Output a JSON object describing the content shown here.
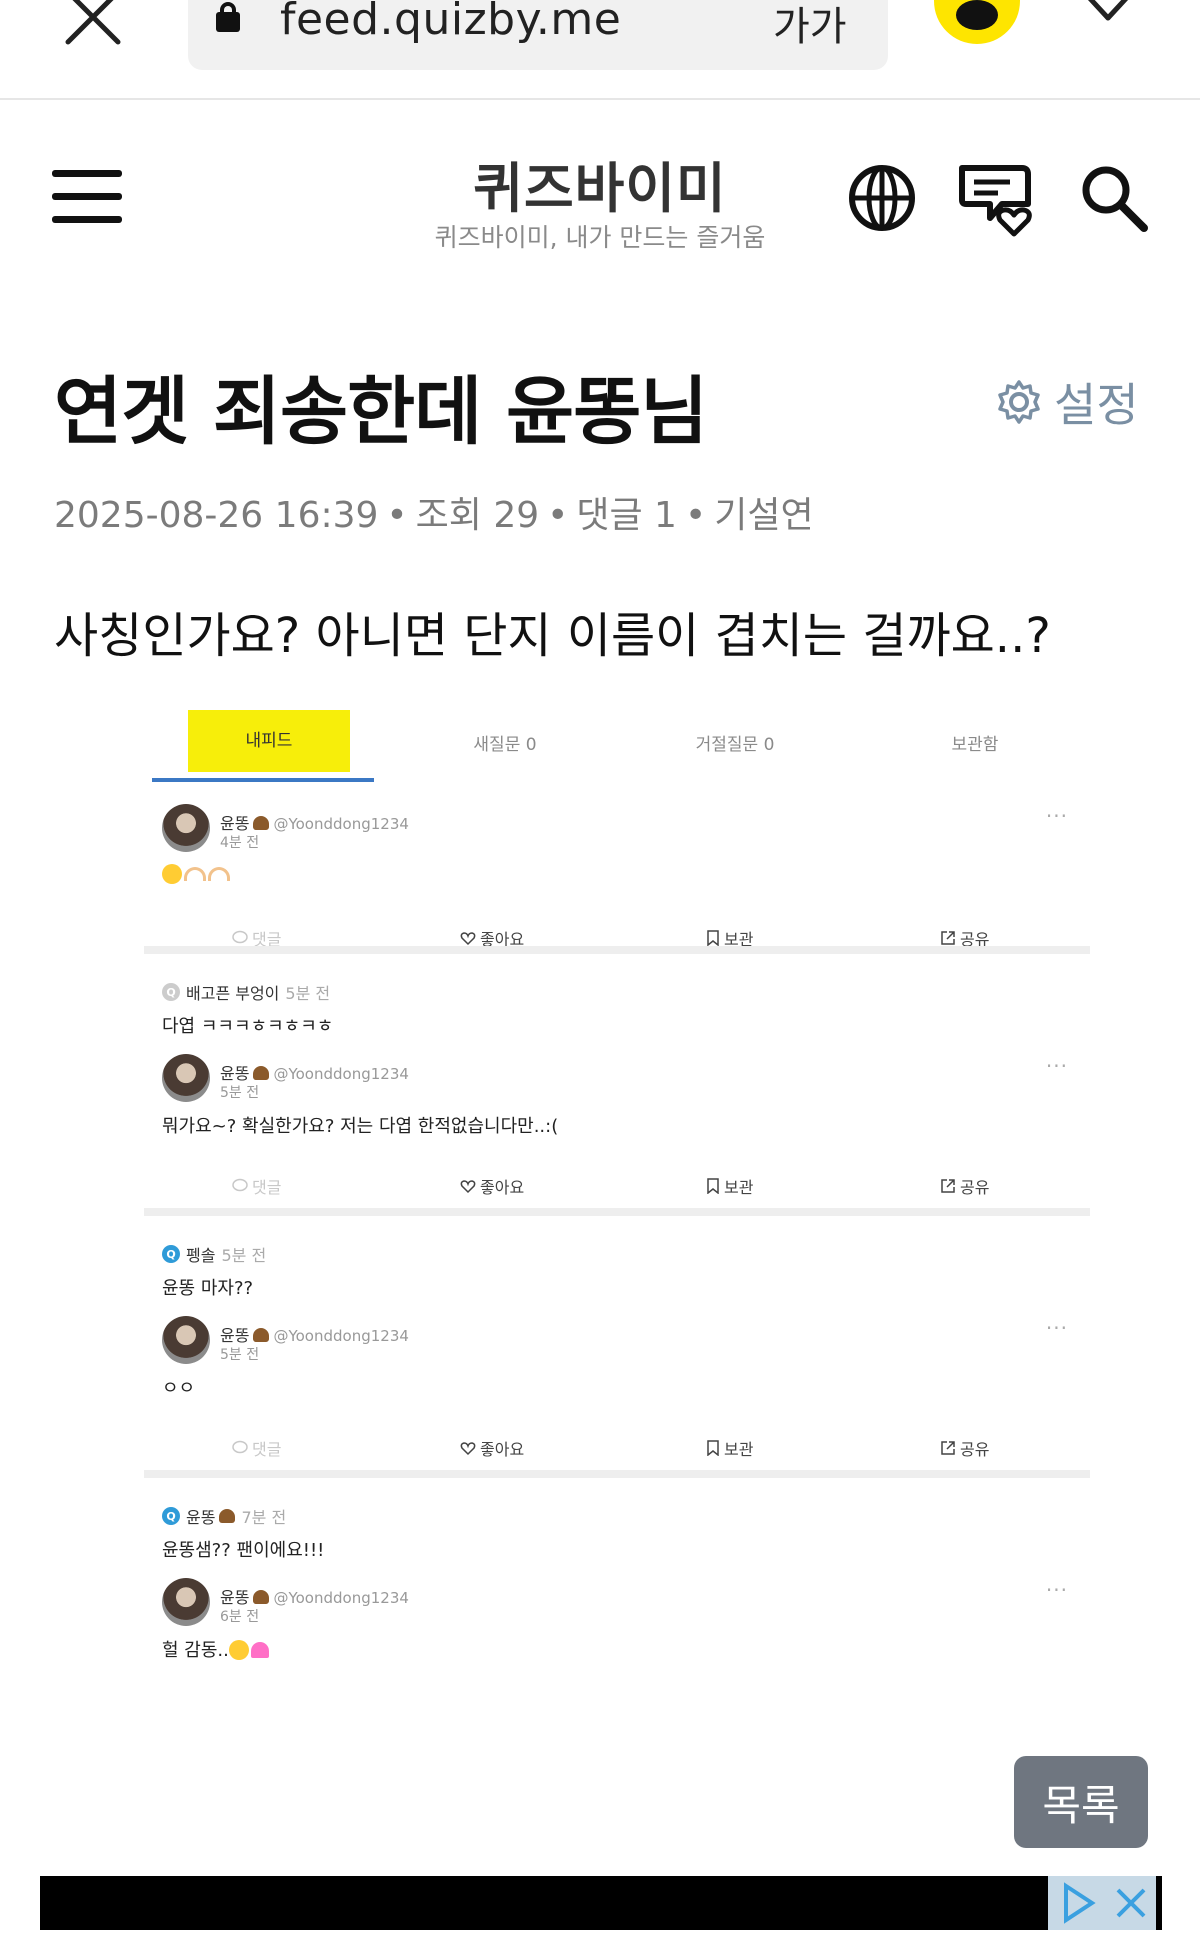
{
  "browser": {
    "url": "feed.quizby.me",
    "font_size_label": "가가"
  },
  "site": {
    "logo": "퀴즈바이미",
    "tagline": "퀴즈바이미, 내가 만드는 즐거움"
  },
  "post": {
    "title": "연겟 죄송한데 윤똥님",
    "settings_label": "설정",
    "date": "2025-08-26 16:39",
    "views": "조회 29",
    "comments": "댓글 1",
    "author": "기설연",
    "body": "사칭인가요? 아니면 단지 이름이 겹치는 걸까요..?"
  },
  "embedded": {
    "tabs": [
      "내피드",
      "새질문 0",
      "거절질문 0",
      "보관함"
    ],
    "actions": {
      "comment": "댓글",
      "like": "좋아요",
      "save": "보관",
      "share": "공유"
    },
    "more_label": "···",
    "items": [
      {
        "answer_author": "윤똥",
        "answer_handle": "@Yoonddong1234",
        "answer_time": "4분 전",
        "answer_text": ""
      },
      {
        "question_author": "배고픈 부엉이",
        "question_time": "5분 전",
        "question_text": "다엽 ㅋㅋㅋㅎㅋㅎㅋㅎ",
        "answer_author": "윤똥",
        "answer_handle": "@Yoonddong1234",
        "answer_time": "5분 전",
        "answer_text": "뭐가요~? 확실한가요? 저는 다엽 한적없습니다만..:("
      },
      {
        "question_author": "펭솔",
        "question_time": "5분 전",
        "question_text": "윤똥 마자??",
        "answer_author": "윤똥",
        "answer_handle": "@Yoonddong1234",
        "answer_time": "5분 전",
        "answer_text": "ㅇㅇ"
      },
      {
        "question_author": "윤똥",
        "question_time": "7분 전",
        "question_text": "윤똥샘?? 팬이에요!!!",
        "answer_author": "윤똥",
        "answer_handle": "@Yoonddong1234",
        "answer_time": "6분 전",
        "answer_text": "헐 감동.."
      }
    ]
  },
  "list_button": "목록",
  "colors": {
    "kakao_yellow": "#fee500",
    "tab_highlight": "#f7ee0a",
    "settings_blue": "#7a8fa3",
    "list_button_bg": "#6f7680"
  }
}
